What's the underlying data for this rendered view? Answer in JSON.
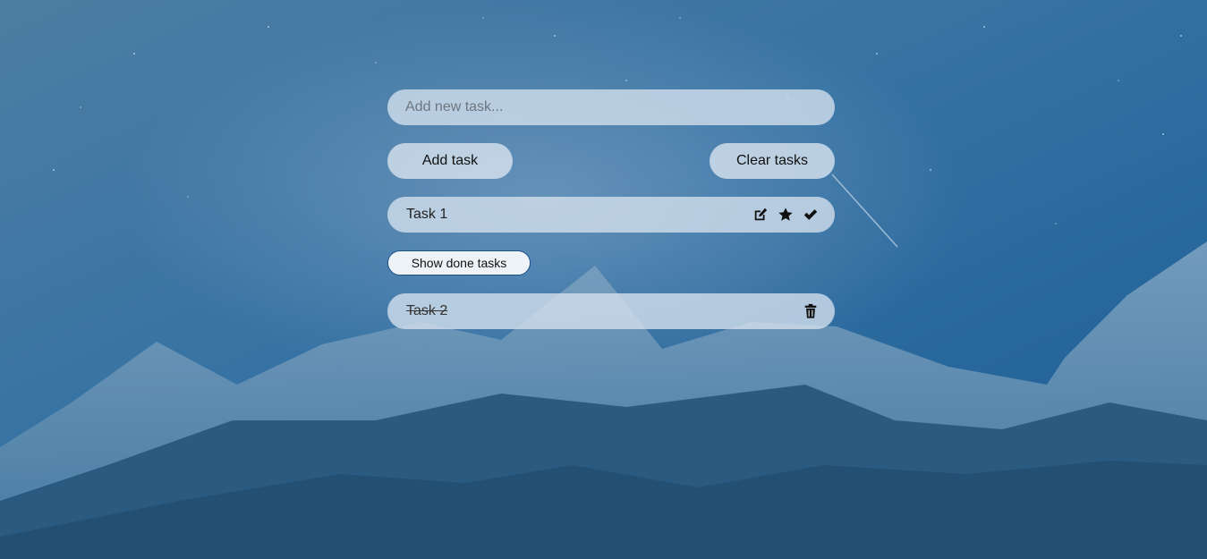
{
  "input": {
    "placeholder": "Add new task...",
    "value": ""
  },
  "buttons": {
    "add_label": "Add task",
    "clear_label": "Clear tasks",
    "show_done_label": "Show done tasks"
  },
  "tasks": [
    {
      "text": "Task 1",
      "actions": [
        "edit-icon",
        "star-icon",
        "check-icon"
      ]
    }
  ],
  "done_tasks": [
    {
      "text": "Task 2",
      "actions": [
        "trash-icon"
      ]
    }
  ],
  "colors": {
    "pill_background": "#d6e2ee",
    "show_done_border": "#1d4f8a",
    "background_sky": "#2d6596"
  }
}
